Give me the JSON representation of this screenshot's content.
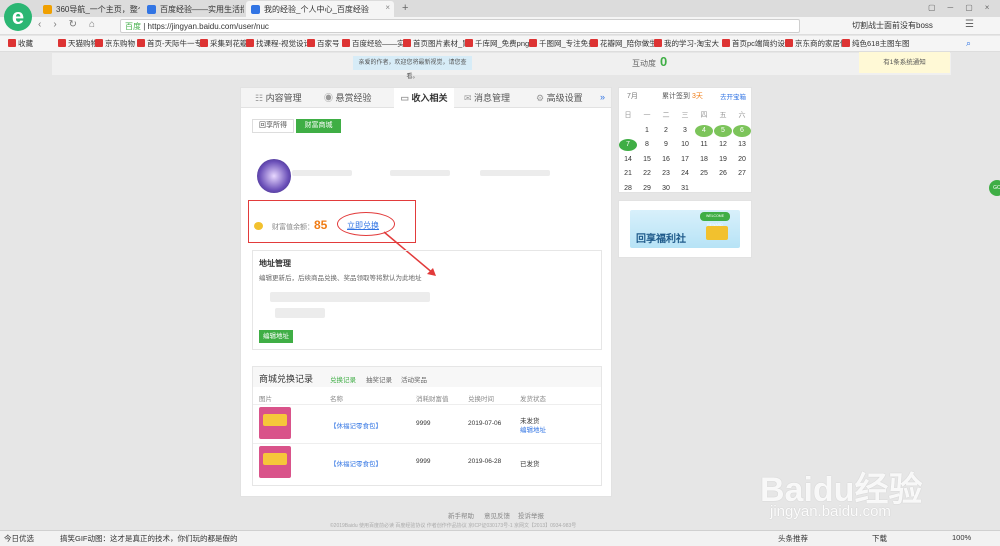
{
  "browser": {
    "tabs": [
      {
        "label": "360导航_一个主页，整个世界",
        "color": "#f0a000"
      },
      {
        "label": "百度经验——实用生活指南",
        "color": "#3275e4"
      },
      {
        "label": "我的经验_个人中心_百度经验",
        "color": "#3275e4"
      }
    ],
    "url_prefix": "百度",
    "url": "https://jingyan.baidu.com/user/nuc",
    "search_hint": "切割战士面前没有boss",
    "bookmarks": [
      "收藏",
      "天猫购物",
      "京东购物",
      "首页-天际牛一专",
      "采集到花瓣",
      "找课程-视觉设计",
      "百家号",
      "百度经验——实",
      "首页图片素材_胃",
      "千库网_免费png",
      "千图网_专注免费",
      "花瓣网_陪你做生",
      "我的学习-淘宝大",
      "首页pc端简约设",
      "京东商的家居促",
      "纯色618主图车图"
    ]
  },
  "header": {
    "notice": "亲爱的作者，欢迎您将最新视觉，请您查看。",
    "interaction_label": "互动度",
    "interaction_value": "0",
    "system_notice": "有1条系统通知"
  },
  "main": {
    "nav": [
      "内容管理",
      "悬赏经验",
      "收入相关",
      "消息管理",
      "高级设置"
    ],
    "nav_more": "»",
    "subtabs": [
      "回享所得",
      "财富商城"
    ],
    "wealth_label": "财富值余额：",
    "wealth_value": "85",
    "redeem_link": "立即兑换",
    "address": {
      "title": "地址管理",
      "desc": "编辑更新后，后续商品兑换、奖品领取等将默认为此地址",
      "edit_button": "编辑地址"
    },
    "records": {
      "title": "商城兑换记录",
      "tabs": [
        "兑换记录",
        "抽奖记录",
        "活动奖品"
      ],
      "columns": [
        "图片",
        "名称",
        "消耗财富值",
        "兑换时间",
        "发货状态"
      ],
      "rows": [
        {
          "name": "【休福记零食包】",
          "cost": "9999",
          "date": "2019-07-06",
          "status": "未发货",
          "status_link": "编辑地址"
        },
        {
          "name": "【休福记零食包】",
          "cost": "9999",
          "date": "2019-06-28",
          "status": "已发货",
          "status_link": ""
        }
      ]
    },
    "footer_links": [
      "新手帮助",
      "意见反馈",
      "投诉举报"
    ],
    "footer_copyright": "©2019Baidu 使用百度前必读 百度经验协议 作者创作作品协议 京ICP证030173号-1 京网文【2013】0934-983号"
  },
  "sidebar": {
    "month": "7月",
    "sign_label": "累计签到",
    "sign_days": "3天",
    "treasure_link": "去开宝箱",
    "weekdays": [
      "日",
      "一",
      "二",
      "三",
      "四",
      "五",
      "六"
    ],
    "dates": [
      [
        "",
        "1",
        "2",
        "3",
        "4",
        "5",
        "6"
      ],
      [
        "7",
        "8",
        "9",
        "10",
        "11",
        "12",
        "13"
      ],
      [
        "14",
        "15",
        "16",
        "17",
        "18",
        "19",
        "20"
      ],
      [
        "21",
        "22",
        "23",
        "24",
        "25",
        "26",
        "27"
      ],
      [
        "28",
        "29",
        "30",
        "31",
        "",
        "",
        ""
      ]
    ],
    "signed": [
      "4",
      "5",
      "6"
    ],
    "today": "7",
    "banner_text": "回享福利社",
    "banner_sub": "WELCOME REWARD"
  },
  "watermark": {
    "brand": "Baidu经验",
    "domain": "jingyan.baidu.com"
  },
  "statusbar": {
    "today": "今日优选",
    "news": "搞笑GIF动图：这才是真正的技术，你们玩的都是假的",
    "right": [
      "头条推荐",
      "下载",
      "100%"
    ]
  }
}
